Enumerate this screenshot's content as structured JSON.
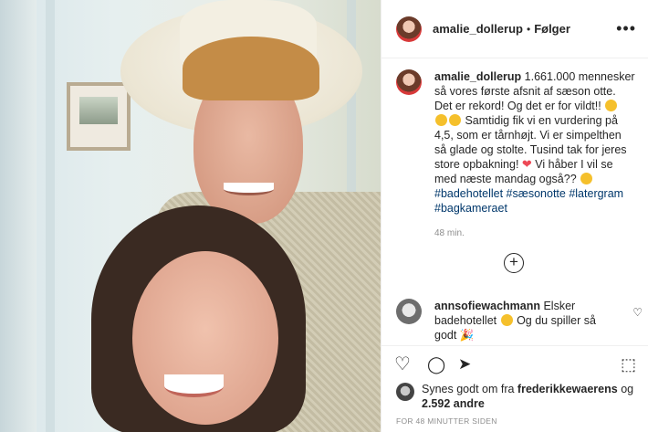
{
  "post": {
    "author": "amalie_dollerup",
    "separator": "•",
    "follow_status": "Følger",
    "more_options": "•••"
  },
  "caption": {
    "author": "amalie_dollerup",
    "line1": " 1.661.000 mennesker så vores første afsnit af sæson otte. Det er rekord! Og det er for vildt!! ",
    "line2": " Samtidig fik vi en vurdering på 4,5, som er tårnhøjt. Vi er simpelthen så glade og stolte. Tusind tak for jeres store opbakning! ",
    "heart": "❤",
    "line3": " Vi håber I vil se med næste mandag også?? ",
    "hashtags": "#badehotellet #sæsonotte #latergram #bagkameraet",
    "time": "48 min."
  },
  "add_comment": {
    "icon": "+"
  },
  "comment": {
    "author": "annsofiewachmann",
    "text_before_emoji": " Elsker badehotellet ",
    "text_after_emoji": " Og du spiller så godt ",
    "party": "🎉"
  },
  "actions": {
    "like": "♡",
    "comment": "◯",
    "share": "➤",
    "save": "⬚"
  },
  "likes": {
    "prefix": "Synes godt om fra ",
    "user": "frederikkewaerens",
    "connector": " og",
    "count": "2.592 andre"
  },
  "footer": {
    "timestamp": "FOR 48 MINUTTER SIDEN"
  },
  "colors": {
    "link": "#00376b",
    "muted": "#8e8e8e",
    "heart": "#ed4956"
  }
}
